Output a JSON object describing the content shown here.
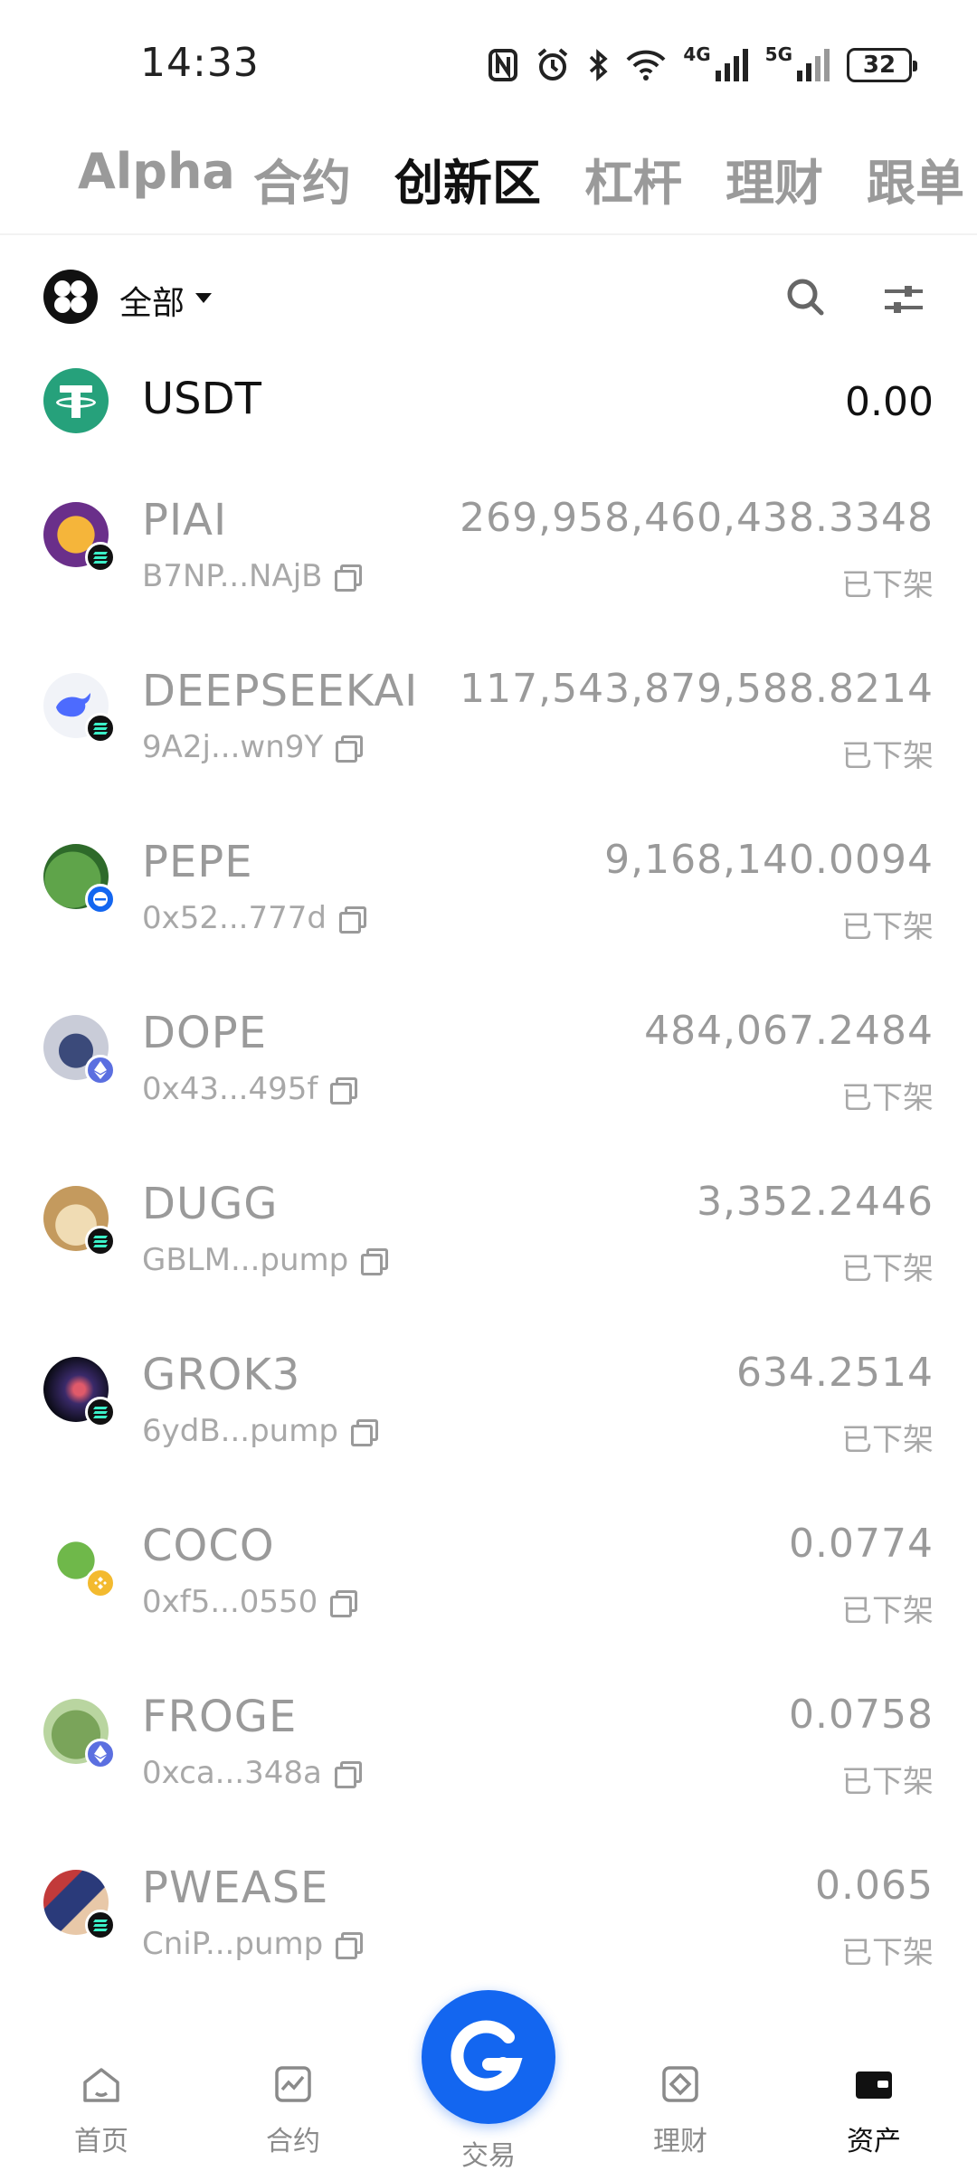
{
  "status_bar": {
    "time": "14:33",
    "network_1": "4G",
    "network_2": "5G",
    "battery": "32"
  },
  "top_tabs": [
    {
      "label": "Alpha",
      "active": false
    },
    {
      "label": "合约",
      "active": false
    },
    {
      "label": "创新区",
      "active": true
    },
    {
      "label": "杠杆",
      "active": false
    },
    {
      "label": "理财",
      "active": false
    },
    {
      "label": "跟单",
      "active": false
    }
  ],
  "filter": {
    "label": "全部"
  },
  "usdt": {
    "name": "USDT",
    "amount": "0.00"
  },
  "tokens": [
    {
      "name": "PIAI",
      "address": "B7NP...NAjB",
      "amount": "269,958,460,438.3348",
      "status": "已下架",
      "chain": "solana-icon"
    },
    {
      "name": "DEEPSEEKAI",
      "address": "9A2j...wn9Y",
      "amount": "117,543,879,588.8214",
      "status": "已下架",
      "chain": "solana-icon"
    },
    {
      "name": "PEPE",
      "address": "0x52...777d",
      "amount": "9,168,140.0094",
      "status": "已下架",
      "chain": "base-icon"
    },
    {
      "name": "DOPE",
      "address": "0x43...495f",
      "amount": "484,067.2484",
      "status": "已下架",
      "chain": "ethereum-icon"
    },
    {
      "name": "DUGG",
      "address": "GBLM...pump",
      "amount": "3,352.2446",
      "status": "已下架",
      "chain": "solana-icon"
    },
    {
      "name": "GROK3",
      "address": "6ydB...pump",
      "amount": "634.2514",
      "status": "已下架",
      "chain": "solana-icon"
    },
    {
      "name": "COCO",
      "address": "0xf5...0550",
      "amount": "0.0774",
      "status": "已下架",
      "chain": "bnb-icon"
    },
    {
      "name": "FROGE",
      "address": "0xca...348a",
      "amount": "0.0758",
      "status": "已下架",
      "chain": "ethereum-icon"
    },
    {
      "name": "PWEASE",
      "address": "CniP...pump",
      "amount": "0.065",
      "status": "已下架",
      "chain": "solana-icon"
    }
  ],
  "bottom_nav": [
    {
      "label": "首页",
      "icon": "home-icon",
      "active": false
    },
    {
      "label": "合约",
      "icon": "chart-icon",
      "active": false
    },
    {
      "label": "交易",
      "icon": "trade-icon",
      "active": false
    },
    {
      "label": "理财",
      "icon": "finance-icon",
      "active": false
    },
    {
      "label": "资产",
      "icon": "wallet-icon",
      "active": true
    }
  ],
  "colors": {
    "accent": "#1366f0",
    "usdt": "#26a17b",
    "solana_badge": "#111111",
    "ethereum_badge": "#5b6fe0",
    "bnb_badge": "#f3ba2f",
    "base_badge": "#1366f0"
  }
}
